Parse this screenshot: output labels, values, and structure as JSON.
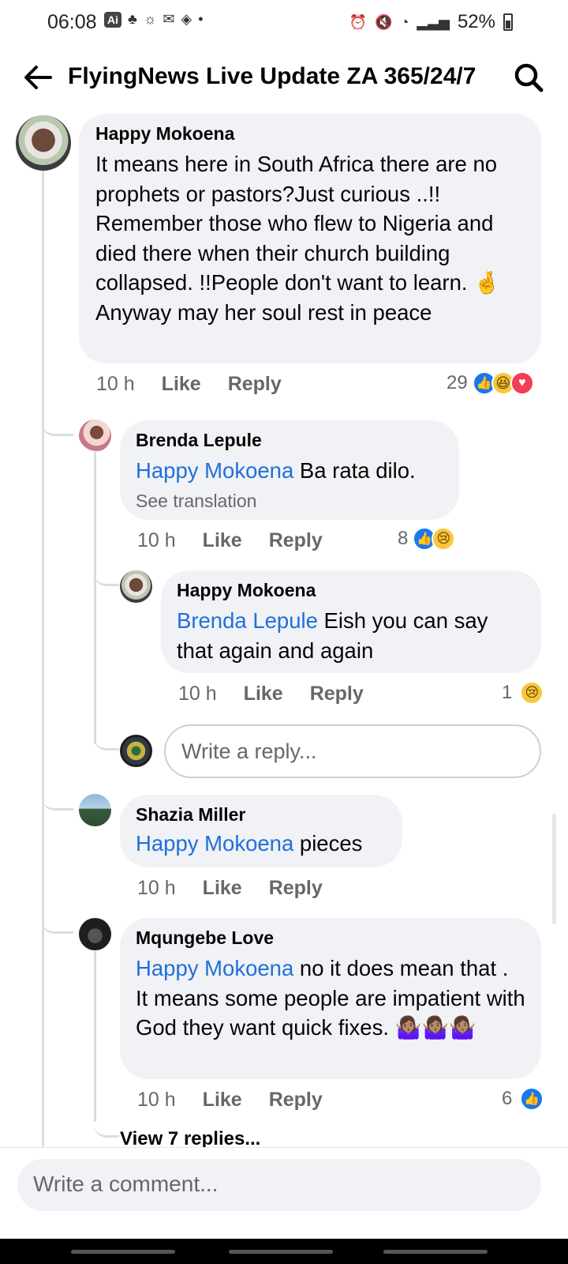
{
  "status_bar": {
    "time": "06:08",
    "ai_badge": "Ai",
    "battery": "52%"
  },
  "header": {
    "title": "FlyingNews Live Update ZA 365/24/7"
  },
  "comments": [
    {
      "author": "Happy Mokoena",
      "text": "It means here in South Africa there are no prophets or pastors?Just curious ..!! Remember those who flew to Nigeria and died there  when their church building collapsed. !!People don't want to learn. 🤞 Anyway may her soul rest in peace",
      "time": "10 h",
      "like": "Like",
      "reply": "Reply",
      "reaction_count": "29"
    },
    {
      "author": "Brenda Lepule",
      "mention": "Happy Mokoena",
      "text": "Ba rata dilo.",
      "see_translation": "See translation",
      "time": "10 h",
      "like": "Like",
      "reply": "Reply",
      "reaction_count": "8"
    },
    {
      "author": "Happy Mokoena",
      "mention": "Brenda Lepule",
      "text": "Eish you can say that again and again",
      "time": "10 h",
      "like": "Like",
      "reply": "Reply",
      "reaction_count": "1"
    },
    {
      "author": "Shazia Miller",
      "mention": "Happy Mokoena",
      "text": "pieces",
      "time": "10 h",
      "like": "Like",
      "reply": "Reply"
    },
    {
      "author": "Mqungebe Love",
      "mention": "Happy Mokoena",
      "text": "no it does mean that . It means some people are impatient with God they want quick fixes. 🤷🏽‍♀️🤷🏽‍♀️🤷🏽‍♀️",
      "time": "10 h",
      "like": "Like",
      "reply": "Reply",
      "reaction_count": "6"
    }
  ],
  "reply_input": {
    "placeholder": "Write a reply..."
  },
  "view_replies": "View 7 replies...",
  "composer": {
    "placeholder": "Write a comment..."
  }
}
